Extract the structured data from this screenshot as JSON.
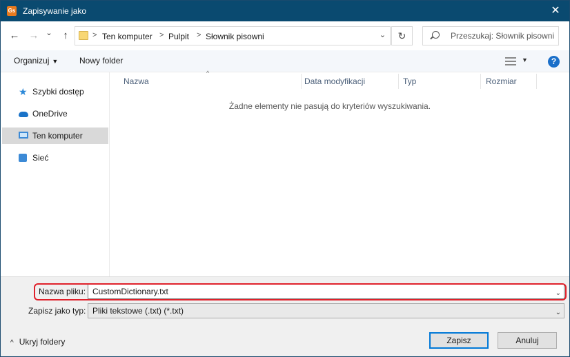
{
  "window": {
    "title": "Zapisywanie jako",
    "app_icon_text": "Gs",
    "close_glyph": "✕"
  },
  "nav": {
    "back_icon": "←",
    "forward_icon": "→",
    "recent_icon": "⌄",
    "up_icon": "↑"
  },
  "address": {
    "crumbs": [
      "Ten komputer",
      "Pulpit",
      "Słownik pisowni"
    ],
    "separator": ">",
    "dropdown_icon": "⌄",
    "refresh_icon": "↻"
  },
  "search": {
    "placeholder": "Przeszukaj: Słownik pisowni"
  },
  "toolbar": {
    "organize_label": "Organizuj",
    "organize_caret": "▼",
    "new_folder_label": "Nowy folder",
    "view_caret": "▼",
    "help_glyph": "?"
  },
  "sidebar": {
    "items": [
      {
        "label": "Szybki dostęp",
        "icon": "star-icon",
        "selected": false
      },
      {
        "label": "OneDrive",
        "icon": "cloud-icon",
        "selected": false
      },
      {
        "label": "Ten komputer",
        "icon": "computer-icon",
        "selected": true
      },
      {
        "label": "Sieć",
        "icon": "network-icon",
        "selected": false
      }
    ]
  },
  "filelist": {
    "sort_arrow": "^",
    "columns": [
      "Nazwa",
      "Data modyfikacji",
      "Typ",
      "Rozmiar"
    ],
    "empty_message": "Żadne elementy nie pasują do kryteriów wyszukiwania."
  },
  "form": {
    "filename_label": "Nazwa pliku:",
    "filename_value": "CustomDictionary.txt",
    "filetype_label": "Zapisz jako typ:",
    "filetype_value": "Pliki tekstowe (.txt) (*.txt)",
    "dropdown_icon": "⌄",
    "hide_folders_label": "Ukryj foldery",
    "hide_caret": "^",
    "save_label": "Zapisz",
    "cancel_label": "Anuluj",
    "highlight_color": "#e0202a"
  }
}
